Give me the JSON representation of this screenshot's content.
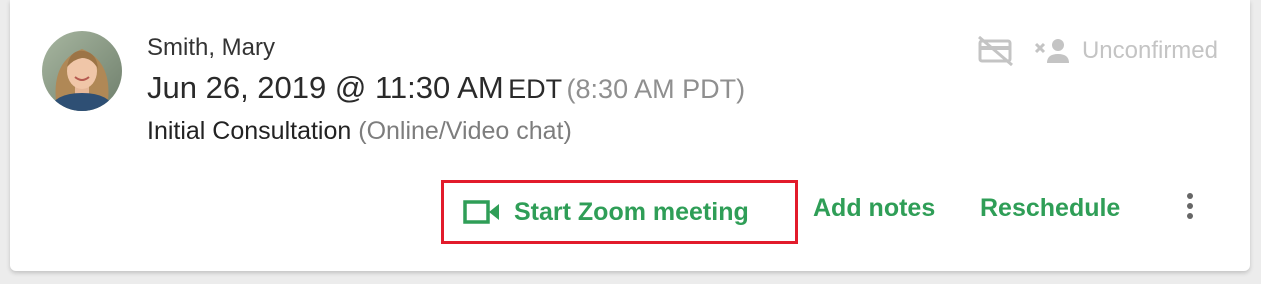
{
  "appointment": {
    "client_name": "Smith, Mary",
    "date_time": "Jun 26, 2019 @ 11:30 AM",
    "timezone": "EDT",
    "alt_time": "(8:30 AM PDT)",
    "service": "Initial Consultation",
    "mode": "(Online/Video chat)"
  },
  "status": {
    "label": "Unconfirmed",
    "icons": [
      "no-payment-card-icon",
      "unconfirmed-person-icon"
    ],
    "color": "#c4c4c4"
  },
  "actions": {
    "zoom_label": "Start Zoom meeting",
    "add_notes_label": "Add notes",
    "reschedule_label": "Reschedule",
    "more_icon": "more-vertical-icon",
    "accent_color": "#2f9e57",
    "highlight_color": "#e21b2b"
  }
}
